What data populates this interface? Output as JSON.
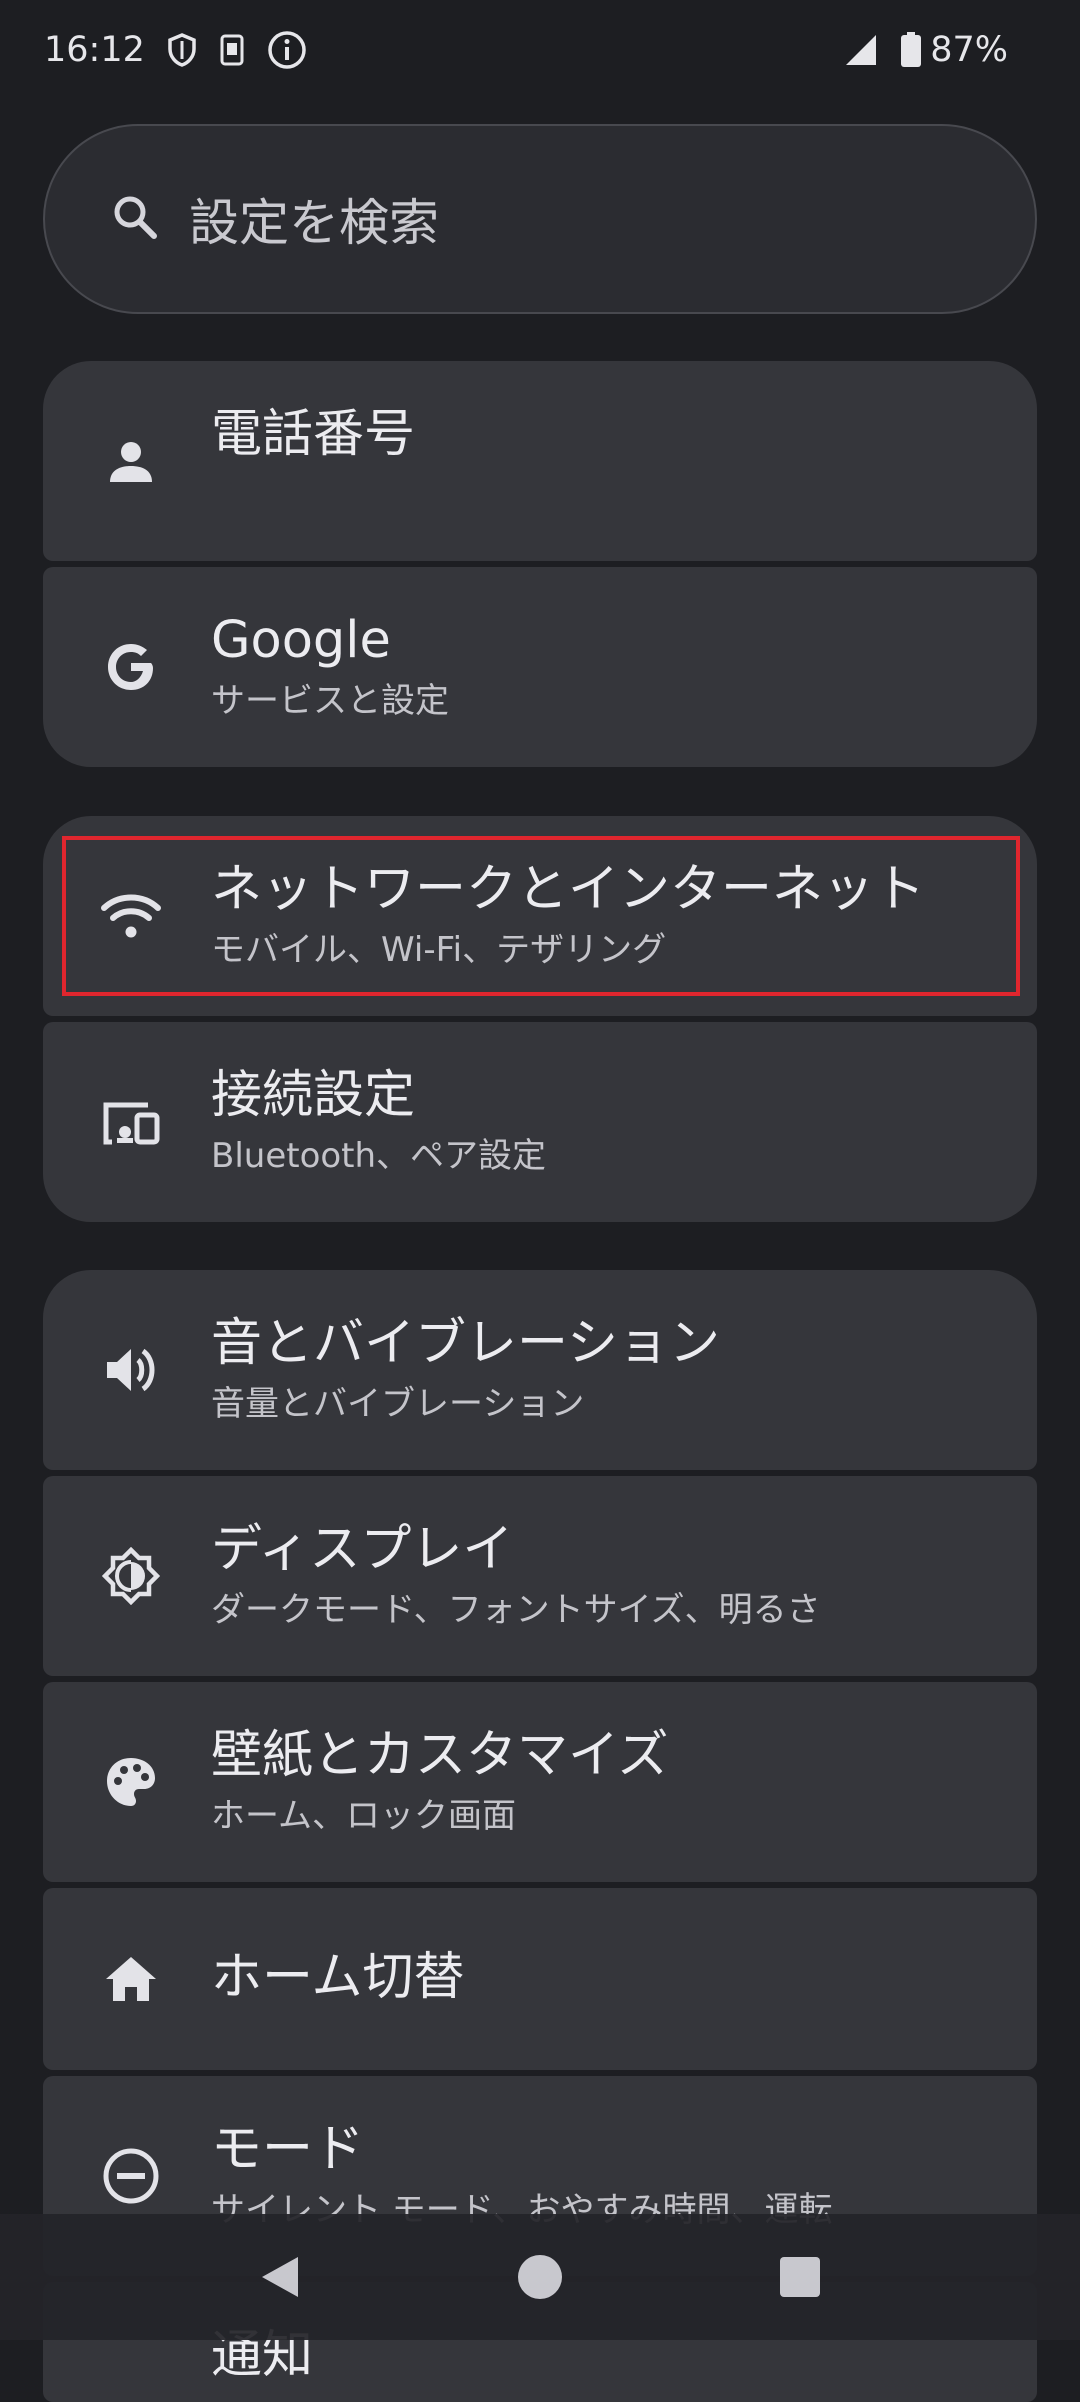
{
  "status_bar": {
    "time": "16:12",
    "battery": "87%",
    "icons": [
      "shield-icon",
      "sim-icon",
      "info-icon",
      "signal-icon",
      "battery-icon"
    ]
  },
  "search": {
    "placeholder": "設定を検索",
    "icon": "search-icon"
  },
  "items": [
    {
      "title": "電話番号",
      "subtitle": "",
      "icon": "person-icon"
    },
    {
      "title": "Google",
      "subtitle": "サービスと設定",
      "icon": "google-icon"
    },
    {
      "title": "ネットワークとインターネット",
      "subtitle": "モバイル、Wi-Fi、テザリング",
      "icon": "wifi-icon"
    },
    {
      "title": "接続設定",
      "subtitle": "Bluetooth、ペア設定",
      "icon": "connected-devices-icon"
    },
    {
      "title": "音とバイブレーション",
      "subtitle": "音量とバイブレーション",
      "icon": "volume-icon"
    },
    {
      "title": "ディスプレイ",
      "subtitle": "ダークモード、フォントサイズ、明るさ",
      "icon": "brightness-icon"
    },
    {
      "title": "壁紙とカスタマイズ",
      "subtitle": "ホーム、ロック画面",
      "icon": "palette-icon"
    },
    {
      "title": "ホーム切替",
      "subtitle": "",
      "icon": "home-icon"
    },
    {
      "title": "モード",
      "subtitle": "サイレント モード、おやすみ時間、運転",
      "icon": "do-not-disturb-icon"
    },
    {
      "title": "通知",
      "subtitle": "",
      "icon": "notifications-icon"
    }
  ],
  "highlight_color": "#e0262e",
  "nav": {
    "back": "back-icon",
    "home": "home-circle-icon",
    "recents": "recents-icon"
  }
}
